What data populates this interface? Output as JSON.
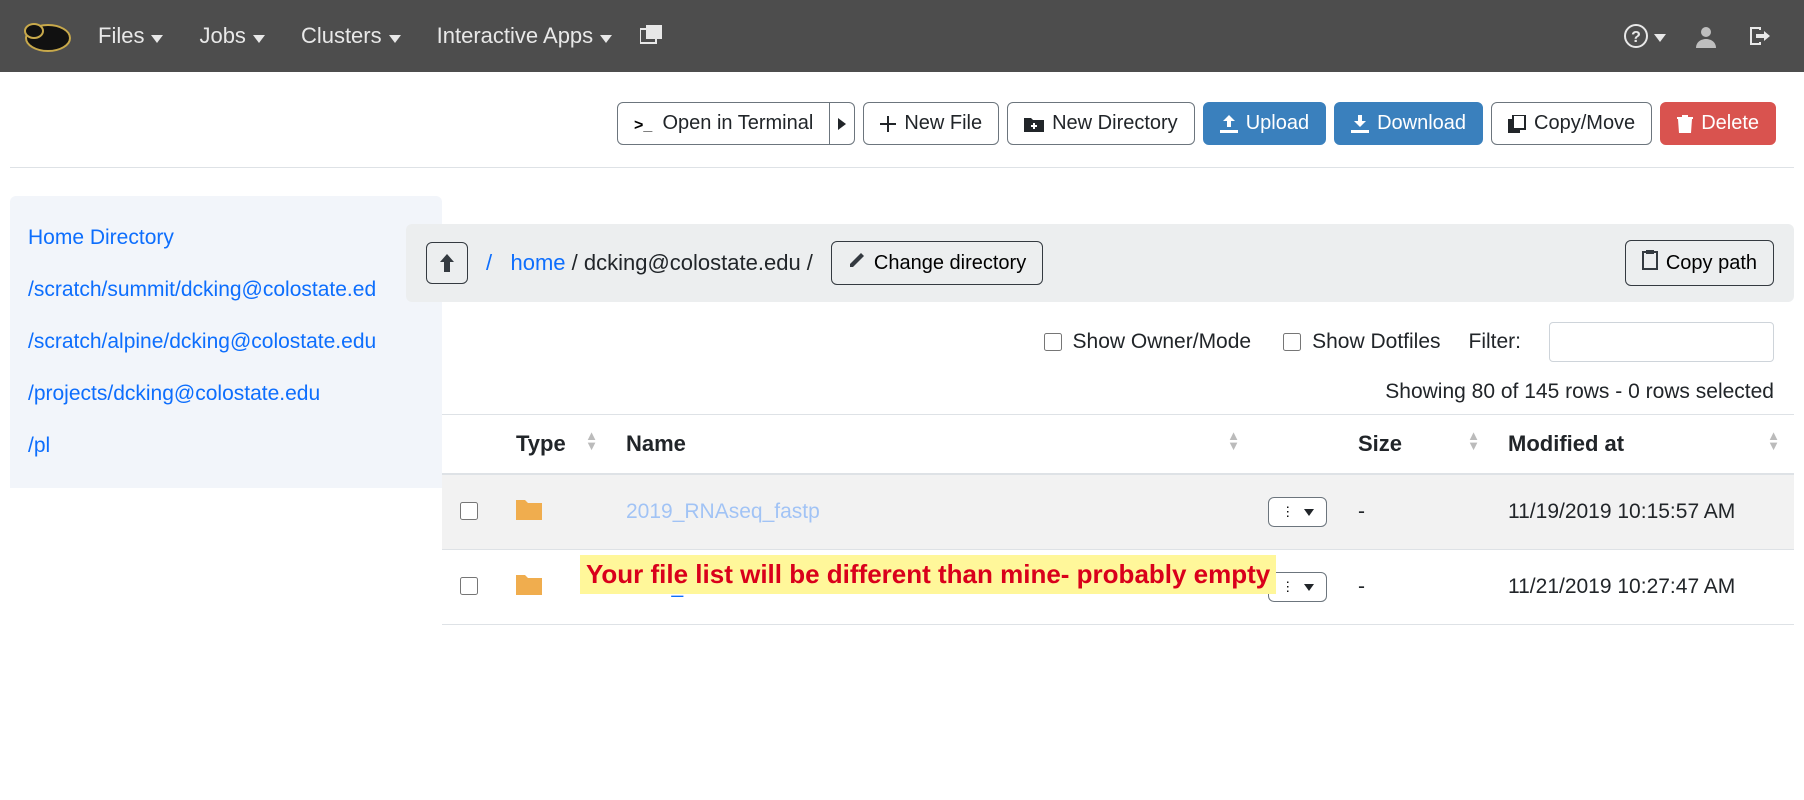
{
  "nav": {
    "items": [
      "Files",
      "Jobs",
      "Clusters",
      "Interactive Apps"
    ]
  },
  "toolbar": {
    "open_terminal": "Open in Terminal",
    "new_file": "New File",
    "new_dir": "New Directory",
    "upload": "Upload",
    "download": "Download",
    "copy_move": "Copy/Move",
    "delete": "Delete"
  },
  "sidebar": {
    "items": [
      "Home Directory",
      "/scratch/summit/dcking@colostate.ed",
      "/scratch/alpine/dcking@colostate.edu",
      "/projects/dcking@colostate.edu",
      "/pl"
    ]
  },
  "pathbar": {
    "root": "/",
    "home": "home",
    "sep": " / ",
    "user": "dcking@colostate.edu /",
    "change_dir": "Change directory",
    "copy_path": "Copy path"
  },
  "filters": {
    "show_owner": "Show Owner/Mode",
    "show_dotfiles": "Show Dotfiles",
    "filter_label": "Filter:"
  },
  "status": "Showing 80 of 145 rows - 0 rows selected",
  "columns": {
    "type": "Type",
    "name": "Name",
    "size": "Size",
    "modified": "Modified at"
  },
  "rows": [
    {
      "name": "2019_RNAseq_fastp",
      "size": "-",
      "modified": "11/19/2019 10:15:57 AM"
    },
    {
      "name": "bash_tests",
      "size": "-",
      "modified": "11/21/2019 10:27:47 AM"
    }
  ],
  "annotation": "Your file list will be different than mine- probably empty"
}
